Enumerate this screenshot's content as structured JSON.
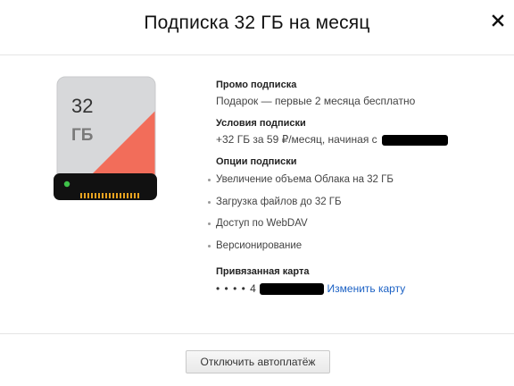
{
  "dialog": {
    "title": "Подписка 32 ГБ на месяц",
    "close_icon": "close-icon"
  },
  "drive": {
    "size_value": "32",
    "size_unit": "ГБ",
    "icon": "hard-drive-icon"
  },
  "promo": {
    "title": "Промо подписка",
    "text": "Подарок — первые 2 месяца бесплатно"
  },
  "terms": {
    "title": "Условия подписки",
    "text": "+32 ГБ за 59 ₽/месяц, начиная с"
  },
  "options": {
    "title": "Опции подписки",
    "items": [
      "Увеличение объема Облака на 32 ГБ",
      "Загрузка файлов до 32 ГБ",
      "Доступ по WebDAV",
      "Версионирование"
    ]
  },
  "card": {
    "title": "Привязанная карта",
    "masked": "• • • • 4",
    "change_link": "Изменить карту"
  },
  "footer": {
    "disable_autopay_label": "Отключить автоплатёж"
  },
  "colors": {
    "accent_link": "#1a60c4",
    "drive_body": "#d7d8da",
    "drive_accent": "#f26d5a",
    "drive_base": "#111111",
    "led": "#3fc24a",
    "connector": "#e8a320"
  }
}
